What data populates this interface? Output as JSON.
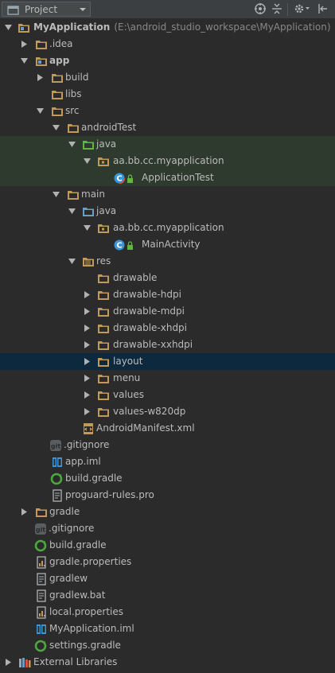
{
  "toolbar": {
    "view_label": "Project",
    "buttons": [
      "target-icon",
      "collapse-icon",
      "gear-icon",
      "hide-icon"
    ]
  },
  "tree": {
    "root_name": "MyApplication",
    "root_path": "(E:\\android_studio_workspace\\MyApplication)",
    "items": [
      {
        "label": ".idea"
      },
      {
        "label": "app"
      },
      {
        "label": "build"
      },
      {
        "label": "libs"
      },
      {
        "label": "src"
      },
      {
        "label": "androidTest"
      },
      {
        "label": "java"
      },
      {
        "label": "aa.bb.cc.myapplication"
      },
      {
        "label": "ApplicationTest"
      },
      {
        "label": "main"
      },
      {
        "label": "java"
      },
      {
        "label": "aa.bb.cc.myapplication"
      },
      {
        "label": "MainActivity"
      },
      {
        "label": "res"
      },
      {
        "label": "drawable"
      },
      {
        "label": "drawable-hdpi"
      },
      {
        "label": "drawable-mdpi"
      },
      {
        "label": "drawable-xhdpi"
      },
      {
        "label": "drawable-xxhdpi"
      },
      {
        "label": "layout"
      },
      {
        "label": "menu"
      },
      {
        "label": "values"
      },
      {
        "label": "values-w820dp"
      },
      {
        "label": "AndroidManifest.xml"
      },
      {
        "label": ".gitignore"
      },
      {
        "label": "app.iml"
      },
      {
        "label": "build.gradle"
      },
      {
        "label": "proguard-rules.pro"
      },
      {
        "label": "gradle"
      },
      {
        "label": ".gitignore"
      },
      {
        "label": "build.gradle"
      },
      {
        "label": "gradle.properties"
      },
      {
        "label": "gradlew"
      },
      {
        "label": "gradlew.bat"
      },
      {
        "label": "local.properties"
      },
      {
        "label": "MyApplication.iml"
      },
      {
        "label": "settings.gradle"
      },
      {
        "label": "External Libraries"
      }
    ]
  },
  "colors": {
    "background": "#2b2b2b",
    "toolbar": "#3c3f41",
    "selection": "#0d293e",
    "test_highlight": "#2e3a2e",
    "folder": "#c19a5b",
    "source_folder": "#6a9fc5",
    "test_folder": "#62b543",
    "class_icon": "#3b94d4"
  }
}
